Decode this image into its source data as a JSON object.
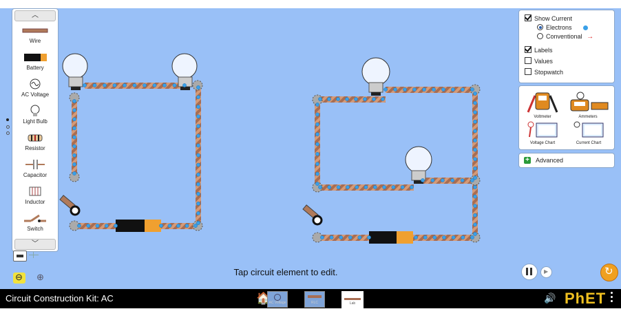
{
  "toolbox": {
    "items": [
      {
        "label": "Wire",
        "icon": "wire-icon"
      },
      {
        "label": "Battery",
        "icon": "battery-icon"
      },
      {
        "label": "AC Voltage",
        "icon": "ac-voltage-icon"
      },
      {
        "label": "Light Bulb",
        "icon": "light-bulb-icon"
      },
      {
        "label": "Resistor",
        "icon": "resistor-icon"
      },
      {
        "label": "Capacitor",
        "icon": "capacitor-icon"
      },
      {
        "label": "Inductor",
        "icon": "inductor-icon"
      },
      {
        "label": "Switch",
        "icon": "switch-icon"
      }
    ]
  },
  "options": {
    "show_current": "Show Current",
    "electrons": "Electrons",
    "conventional": "Conventional",
    "labels": "Labels",
    "values": "Values",
    "stopwatch": "Stopwatch",
    "show_current_checked": true,
    "electrons_selected": true,
    "labels_checked": true,
    "values_checked": false,
    "stopwatch_checked": false
  },
  "tools": {
    "voltmeter": "Voltmeter",
    "ammeters": "Ammeters",
    "voltage_chart": "Voltage Chart",
    "current_chart": "Current Chart"
  },
  "advanced": {
    "label": "Advanced"
  },
  "hint": "Tap circuit element to edit.",
  "footer": {
    "app_title": "Circuit Construction Kit: AC",
    "screens": [
      {
        "label": "AC Voltage"
      },
      {
        "label": "RLC"
      },
      {
        "label": "Lab"
      }
    ],
    "brand": "PhET"
  },
  "colors": {
    "background": "#99c0f7",
    "electron": "#3aa0e8",
    "conventional_arrow": "#e02020",
    "wire": "#b07a5a",
    "footer": "#000000"
  }
}
